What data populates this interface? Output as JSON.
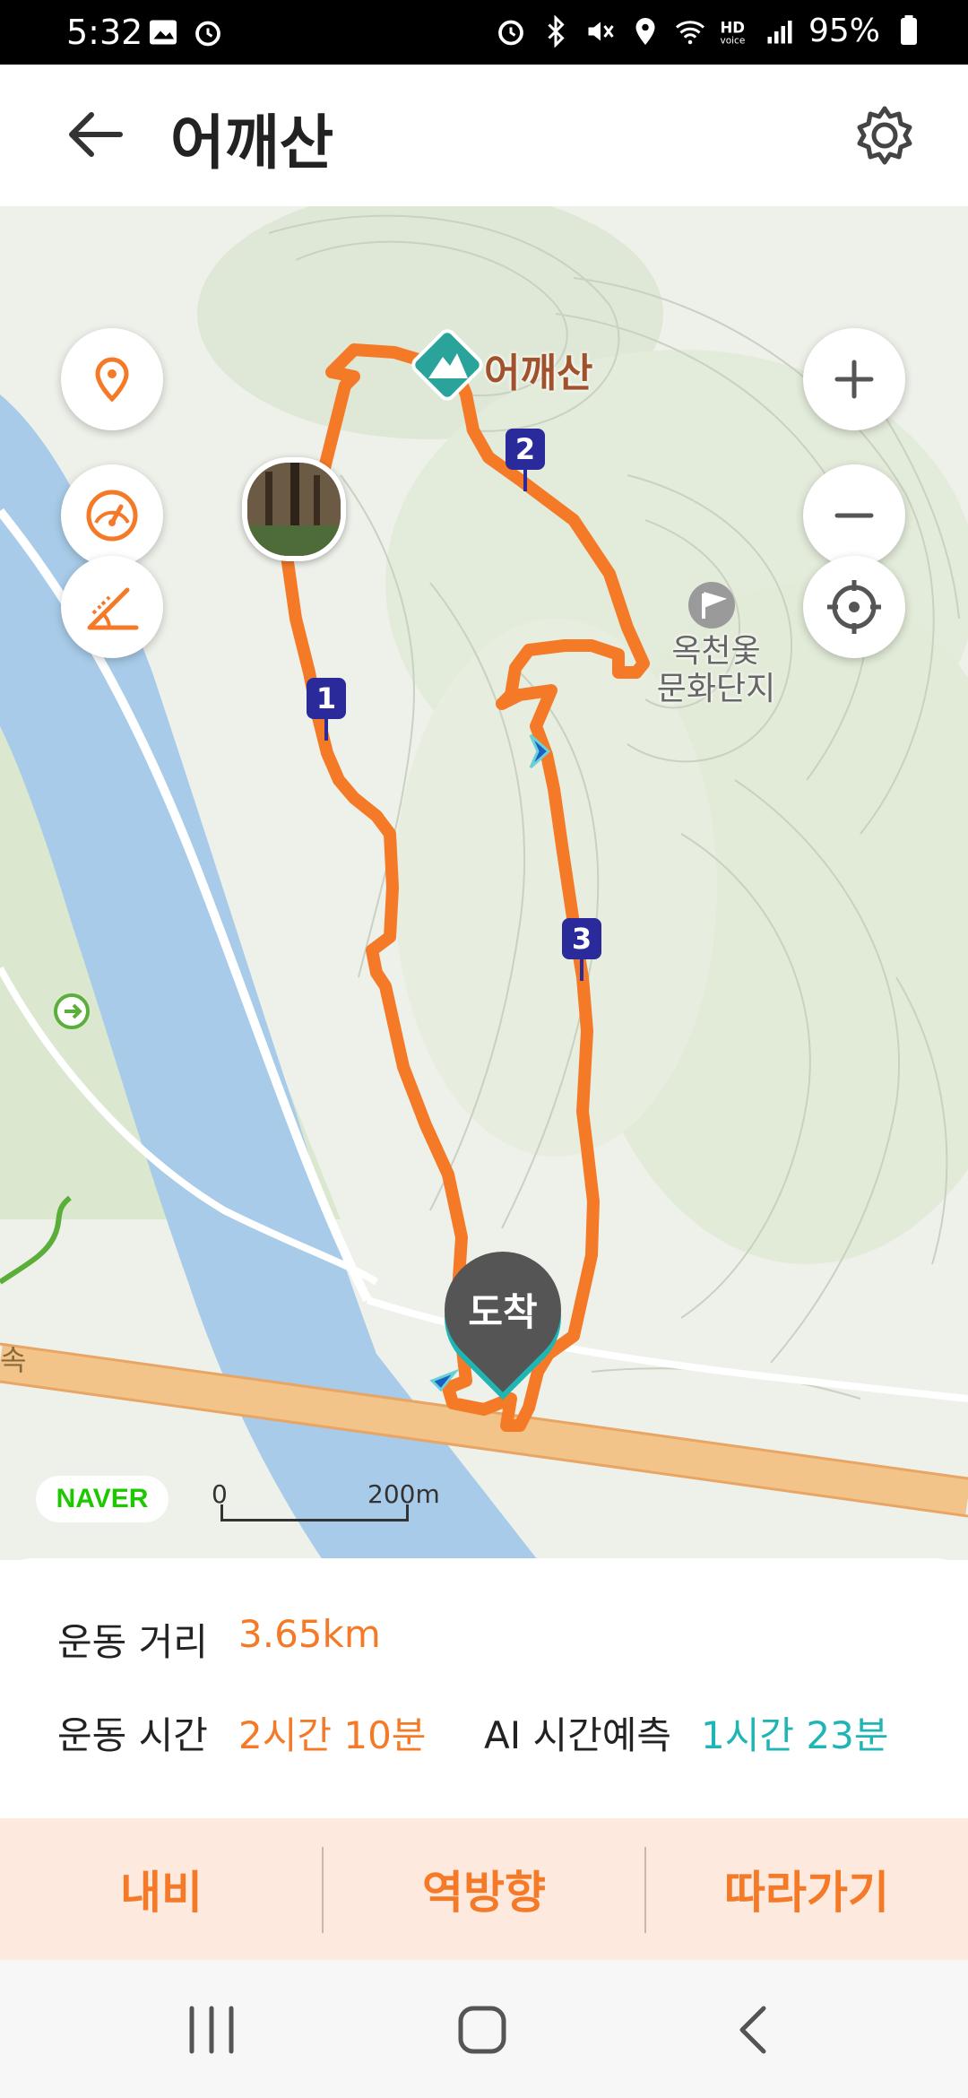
{
  "status_bar": {
    "time": "5:32",
    "battery": "95%",
    "icons": [
      "gallery-icon",
      "alarm-icon",
      "alarm-icon",
      "bluetooth-icon",
      "mute-icon",
      "location-icon",
      "wifi-icon",
      "hd-voice-icon",
      "signal-icon",
      "battery-icon"
    ]
  },
  "header": {
    "title": "어깨산",
    "back_icon": "back-arrow-icon",
    "settings_icon": "gear-icon"
  },
  "map": {
    "summit_label": "어깨산",
    "poi_label": "옥천옻\n문화단지",
    "route_markers": [
      "1",
      "2",
      "3"
    ],
    "arrival_label": "도착",
    "edge_label": "속",
    "provider": "NAVER",
    "scale_start": "0",
    "scale_end": "200m",
    "left_controls": [
      "location-pin-icon",
      "speedometer-icon",
      "slope-icon"
    ],
    "right_controls": [
      "zoom-in-icon",
      "zoom-out-icon",
      "crosshair-icon"
    ],
    "colors": {
      "route": "#f47a28",
      "river": "#a7cbe8",
      "road": "#f3c48a"
    }
  },
  "stats": {
    "distance_label": "운동 거리",
    "distance_value": "3.65km",
    "time_label": "운동 시간",
    "time_value": "2시간 10분",
    "ai_label": "AI 시간예측",
    "ai_value": "1시간 23분"
  },
  "actions": {
    "navi": "내비",
    "reverse": "역방향",
    "follow": "따라가기"
  },
  "navbar": [
    "recent-apps-icon",
    "home-icon",
    "back-icon"
  ]
}
